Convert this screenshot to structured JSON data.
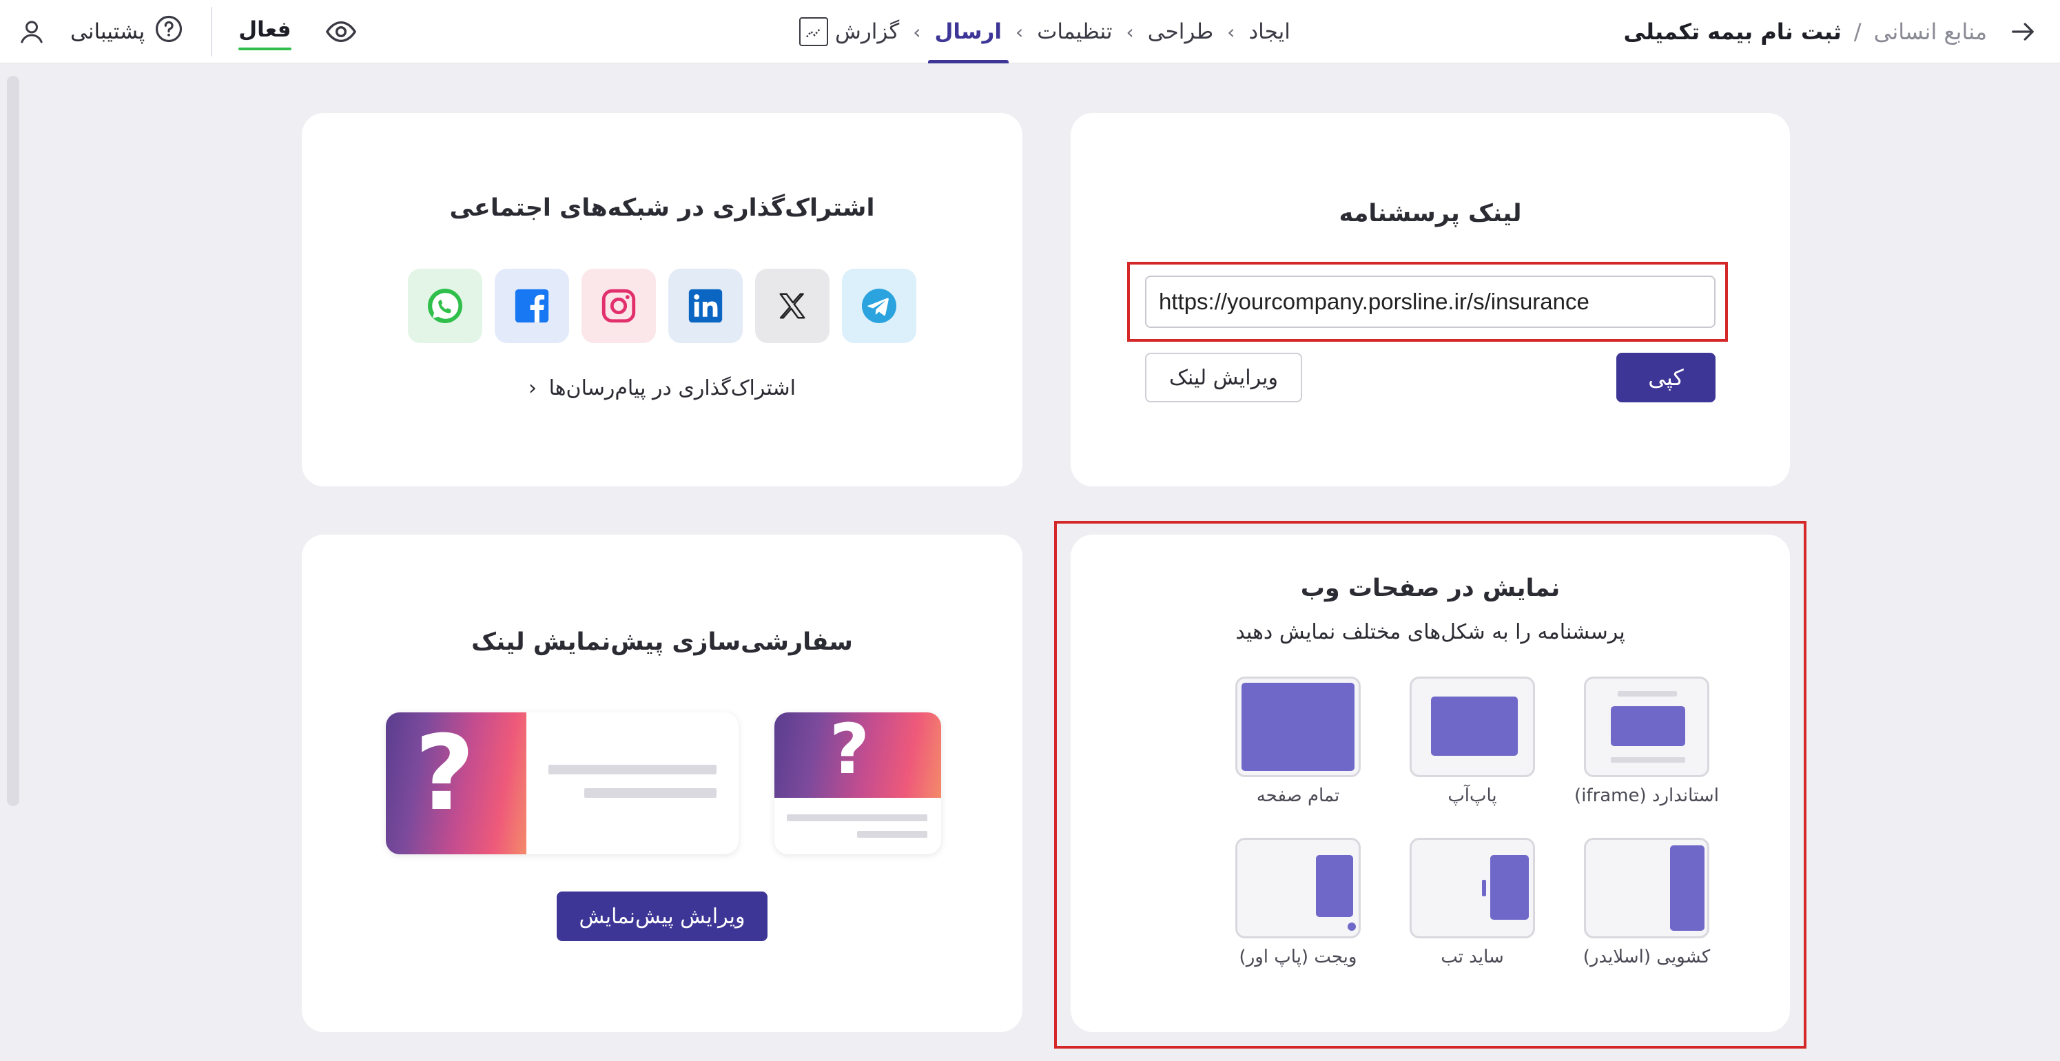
{
  "header": {
    "breadcrumb_parent": "منابع انسانی",
    "breadcrumb_separator": "/",
    "breadcrumb_current": "ثبت نام بیمه تکمیلی",
    "steps": [
      "ایجاد",
      "طراحی",
      "تنظیمات",
      "ارسال",
      "گزارش"
    ],
    "active_step": "ارسال",
    "status": "فعال",
    "support": "پشتیبانی"
  },
  "link_card": {
    "title": "لینک پرسشنامه",
    "url": "https://yourcompany.porsline.ir/s/insurance",
    "copy_label": "کپی",
    "edit_label": "ویرایش لینک"
  },
  "social_card": {
    "title": "اشتراک‌گذاری در شبکه‌های اجتماعی",
    "networks": [
      "telegram",
      "x",
      "linkedin",
      "instagram",
      "facebook",
      "whatsapp"
    ],
    "messenger_link": "اشتراک‌گذاری در پیام‌رسان‌ها"
  },
  "web_card": {
    "title": "نمایش در صفحات وب",
    "subtitle": "پرسشنامه را به شکل‌های مختلف نمایش دهید",
    "options": [
      {
        "label": "استاندارد (iframe)"
      },
      {
        "label": "پاپ‌آپ"
      },
      {
        "label": "تمام صفحه"
      },
      {
        "label": "کشویی (اسلایدر)"
      },
      {
        "label": "ساید تب"
      },
      {
        "label": "ویجت (پاپ اور)"
      }
    ]
  },
  "preview_card": {
    "title": "سفارشی‌سازی پیش‌نمایش لینک",
    "button_label": "ویرایش پیش‌نمایش"
  },
  "colors": {
    "primary": "#3d3696",
    "accent_purple": "#7068c8",
    "active_green": "#2fbf4a",
    "highlight_red": "#d42828"
  }
}
